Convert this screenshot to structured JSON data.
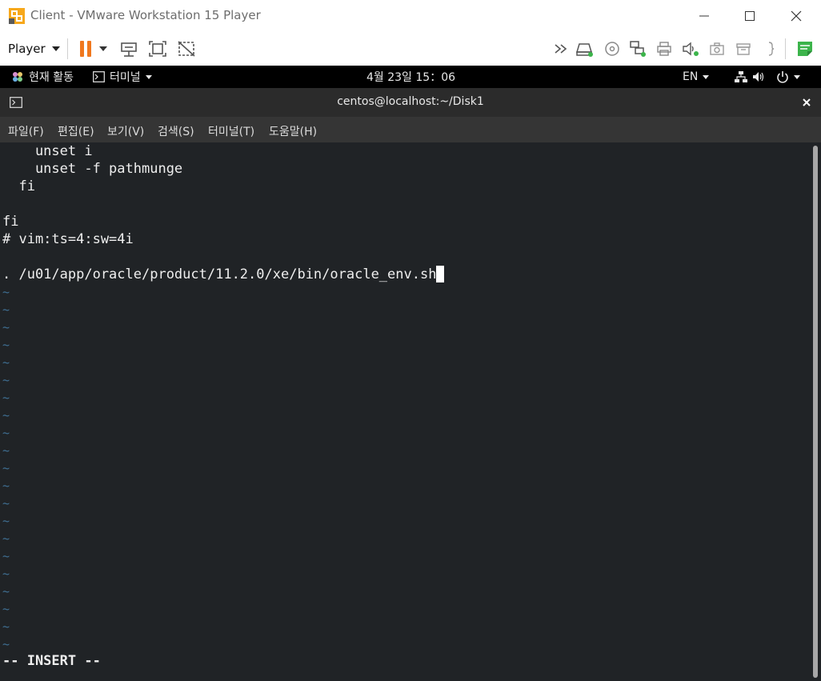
{
  "window": {
    "title": "Client - VMware Workstation 15 Player",
    "minimize_icon": "minimize-icon",
    "maximize_icon": "maximize-icon",
    "close_icon": "close-icon"
  },
  "toolbar": {
    "player_label": "Player",
    "icons": [
      "pause-icon",
      "chevron-down-icon",
      "send-ctrl-alt-del-icon",
      "fullscreen-icon",
      "unity-icon",
      "forward-icon",
      "harddisk-icon",
      "cdrom-icon",
      "network-icon",
      "printer-icon",
      "sound-icon",
      "camera-icon",
      "usb-icon",
      "serial-icon",
      "message-icon"
    ]
  },
  "gnome": {
    "activities": "현재 활동",
    "terminal_menu": "터미널",
    "clock": "4월 23일  15：06",
    "language": "EN"
  },
  "terminal": {
    "title": "centos@localhost:~/Disk1",
    "menu": [
      "파일(F)",
      "편집(E)",
      "보기(V)",
      "검색(S)",
      "터미널(T)",
      "도움말(H)"
    ],
    "lines": [
      "    unset i",
      "    unset -f pathmunge",
      "  fi",
      "",
      "fi",
      "# vim:ts=4:sw=4i",
      "",
      ". /u01/app/oracle/product/11.2.0/xe/bin/oracle_env.sh"
    ],
    "tilde": "~",
    "mode": "-- INSERT --"
  },
  "colors": {
    "terminal_bg": "#202326",
    "tilde": "#3f6f93",
    "pause_orange": "#f0781e",
    "status_green": "#3cb44b"
  }
}
